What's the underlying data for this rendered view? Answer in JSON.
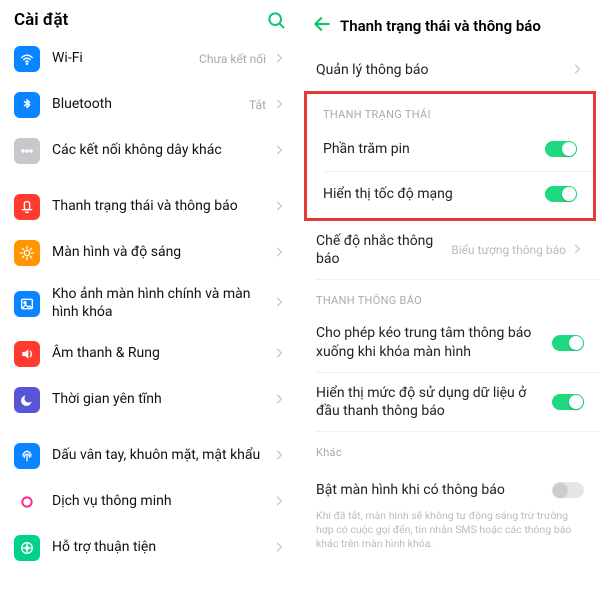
{
  "left": {
    "title": "Cài đặt",
    "items": [
      {
        "icon": "wifi",
        "color": "#0a84ff",
        "label": "Wi-Fi",
        "sub": "Chưa kết nối",
        "chev": true
      },
      {
        "icon": "bluetooth",
        "color": "#0a84ff",
        "label": "Bluetooth",
        "sub": "Tắt",
        "chev": true
      },
      {
        "icon": "dots",
        "color": "#c7c7cc",
        "label": "Các kết nối không dây khác",
        "sub": "",
        "chev": true
      },
      {
        "spacer": true
      },
      {
        "icon": "bell",
        "color": "#ff3b30",
        "label": "Thanh trạng thái và thông báo",
        "sub": "",
        "chev": true
      },
      {
        "icon": "sun",
        "color": "#ff9500",
        "label": "Màn hình và độ sáng",
        "sub": "",
        "chev": true
      },
      {
        "icon": "gallery",
        "color": "#0a84ff",
        "label": "Kho ảnh màn hình chính và màn hình khóa",
        "sub": "",
        "chev": true
      },
      {
        "icon": "sound",
        "color": "#ff3b30",
        "label": "Âm thanh & Rung",
        "sub": "",
        "chev": true
      },
      {
        "icon": "moon",
        "color": "#5856d6",
        "label": "Thời gian yên tĩnh",
        "sub": "",
        "chev": true
      },
      {
        "spacer": true
      },
      {
        "icon": "finger",
        "color": "#0a84ff",
        "label": "Dấu vân tay, khuôn mặt, mật khẩu",
        "sub": "",
        "chev": true
      },
      {
        "icon": "circle-o",
        "color": "#ff2d92",
        "label": "Dịch vụ thông minh",
        "sub": "",
        "chev": true
      },
      {
        "icon": "support",
        "color": "#00d28a",
        "label": "Hỗ trợ thuận tiện",
        "sub": "",
        "chev": true
      }
    ]
  },
  "right": {
    "title": "Thanh trạng thái và thông báo",
    "manage": "Quản lý thông báo",
    "sec1": "THANH TRẠNG THÁI",
    "battery": "Phần trăm pin",
    "netspeed": "Hiển thị tốc độ mạng",
    "remind": "Chế độ nhắc thông báo",
    "remind_val": "Biểu tượng thông báo",
    "sec2": "THANH THÔNG BÁO",
    "drag": "Cho phép kéo trung tâm thông báo xuống khi khóa màn hình",
    "datausage": "Hiển thị mức độ sử dụng dữ liệu ở đầu thanh thông báo",
    "sec3": "Khác",
    "wake": "Bật màn hình khi có thông báo",
    "wake_note": "Khi đã tắt, màn hình sẽ không tự động sáng trừ trường hợp có cuộc gọi đến, tin nhắn SMS hoặc các thông báo khác trên màn hình khóa."
  }
}
